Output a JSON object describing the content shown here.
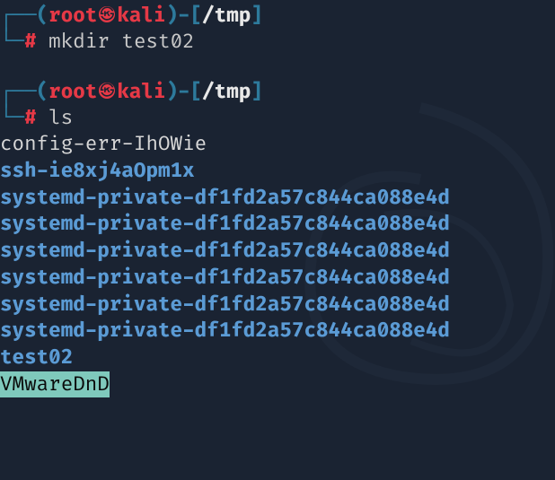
{
  "prompt1": {
    "box_top": "┌──",
    "open_paren": "(",
    "user": "root",
    "at_glyph": "㉿",
    "host": "kali",
    "close_paren": ")",
    "dash": "-",
    "open_bracket": "[",
    "path": "/tmp",
    "close_bracket": "]",
    "box_bottom": "└─",
    "hash": "#",
    "cmd": "mkdir",
    "arg": "test02"
  },
  "prompt2": {
    "box_top": "┌──",
    "open_paren": "(",
    "user": "root",
    "at_glyph": "㉿",
    "host": "kali",
    "close_paren": ")",
    "dash": "-",
    "open_bracket": "[",
    "path": "/tmp",
    "close_bracket": "]",
    "box_bottom": "└─",
    "hash": "#",
    "cmd": "ls"
  },
  "output": {
    "line1": "config-err-IhOWie",
    "line2": "ssh-ie8xj4aOpm1x",
    "line3": "systemd-private-df1fd2a57c844ca088e4d",
    "line4": "systemd-private-df1fd2a57c844ca088e4d",
    "line5": "systemd-private-df1fd2a57c844ca088e4d",
    "line6": "systemd-private-df1fd2a57c844ca088e4d",
    "line7": "systemd-private-df1fd2a57c844ca088e4d",
    "line8": "systemd-private-df1fd2a57c844ca088e4d",
    "line9": "test02",
    "line10": "VMwareDnD"
  }
}
